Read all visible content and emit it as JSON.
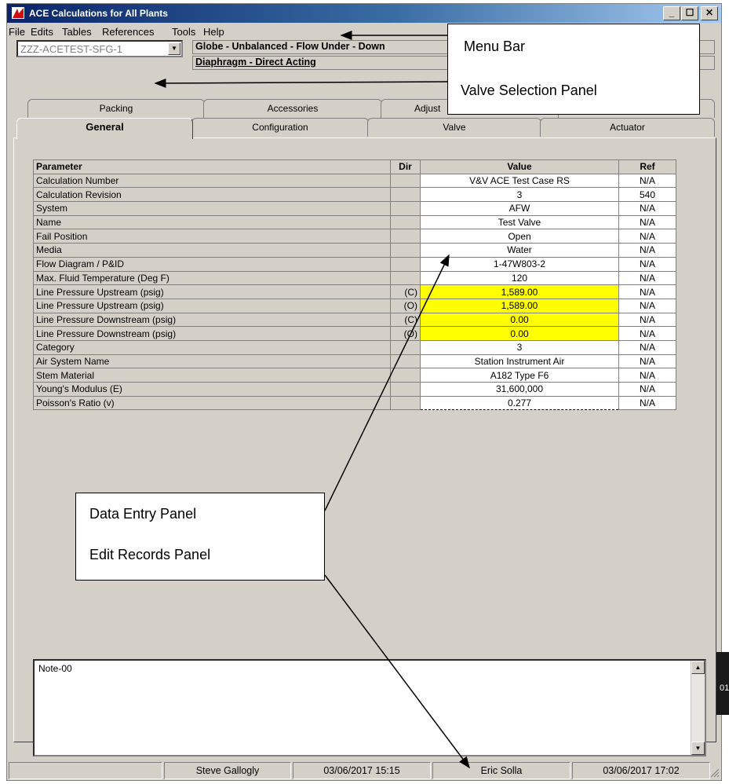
{
  "window": {
    "title": "ACE Calculations for All Plants",
    "controls": {
      "minimize": "_",
      "maximize": "☐",
      "close": "✕"
    }
  },
  "menu": [
    "File",
    "Edits",
    "Tables",
    "References",
    "Tools",
    "Help"
  ],
  "valve_selection": {
    "selected": "ZZZ-ACETEST-SFG-1",
    "valve_type": "Globe - Unbalanced - Flow Under - Down",
    "actuator_type": "Diaphragm - Direct Acting"
  },
  "tabs_back": [
    "Packing",
    "Accessories",
    "Adjust"
  ],
  "tabs_front": [
    "General",
    "Configuration",
    "Valve",
    "Actuator"
  ],
  "active_tab": "General",
  "grid": {
    "headers": {
      "parameter": "Parameter",
      "dir": "Dir",
      "value": "Value",
      "ref": "Ref"
    },
    "rows": [
      {
        "parameter": "Calculation Number",
        "dir": "",
        "value": "V&V ACE Test Case RS",
        "ref": "N/A"
      },
      {
        "parameter": "Calculation Revision",
        "dir": "",
        "value": "3",
        "ref": "540"
      },
      {
        "parameter": "System",
        "dir": "",
        "value": "AFW",
        "ref": "N/A"
      },
      {
        "parameter": "Name",
        "dir": "",
        "value": "Test Valve",
        "ref": "N/A"
      },
      {
        "parameter": "Fail Position",
        "dir": "",
        "value": "Open",
        "ref": "N/A"
      },
      {
        "parameter": "Media",
        "dir": "",
        "value": "Water",
        "ref": "N/A"
      },
      {
        "parameter": "Flow Diagram / P&ID",
        "dir": "",
        "value": "1-47W803-2",
        "ref": "N/A"
      },
      {
        "parameter": "Max. Fluid Temperature (Deg F)",
        "dir": "",
        "value": "120",
        "ref": "N/A"
      },
      {
        "parameter": "Line Pressure Upstream (psig)",
        "dir": "(C)",
        "value": "1,589.00",
        "ref": "N/A"
      },
      {
        "parameter": "Line Pressure Upstream (psig)",
        "dir": "(O)",
        "value": "1,589.00",
        "ref": "N/A"
      },
      {
        "parameter": "Line Pressure Downstream (psig)",
        "dir": "(C)",
        "value": "0.00",
        "ref": "N/A"
      },
      {
        "parameter": "Line Pressure Downstream (psig)",
        "dir": "(O)",
        "value": "0.00",
        "ref": "N/A"
      },
      {
        "parameter": "Category",
        "dir": "",
        "value": "3",
        "ref": "N/A"
      },
      {
        "parameter": "Air System Name",
        "dir": "",
        "value": "Station Instrument Air",
        "ref": "N/A"
      },
      {
        "parameter": "Stem Material",
        "dir": "",
        "value": "A182 Type F6",
        "ref": "N/A"
      },
      {
        "parameter": "Young's Modulus (E)",
        "dir": "",
        "value": "31,600,000",
        "ref": "N/A"
      },
      {
        "parameter": "Poisson's Ratio (v)",
        "dir": "",
        "value": "0.277",
        "ref": "N/A"
      }
    ],
    "highlight_color": "#ffff00"
  },
  "notes": {
    "text": "Note-00"
  },
  "status": {
    "created_by": "Steve Gallogly",
    "created_at": "03/06/2017 15:15",
    "modified_by": "Eric Solla",
    "modified_at": "03/06/2017 17:02"
  },
  "callouts": {
    "menu_bar": "Menu Bar",
    "valve_selection_panel": "Valve Selection Panel",
    "data_entry_panel": "Data Entry Panel",
    "edit_records_panel": "Edit Records Panel"
  },
  "edge_fragment": "01"
}
